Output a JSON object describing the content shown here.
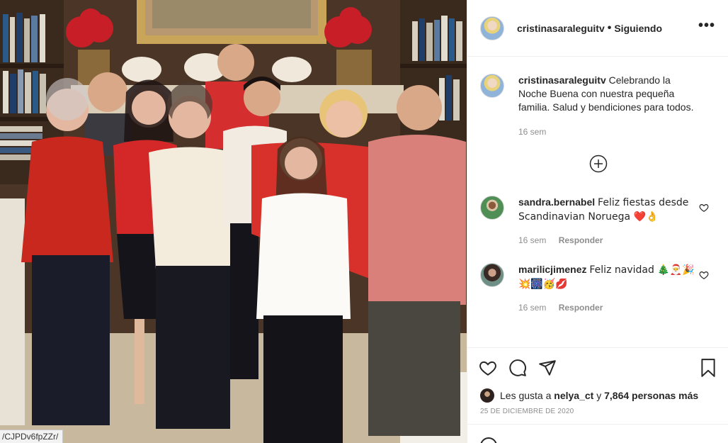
{
  "photo": {
    "url_tooltip": "/CJPDv6fpZZr/",
    "alt": "group photo"
  },
  "post_header": {
    "username": "cristinasaraleguitv",
    "separator": "•",
    "follow_status": "Siguiendo",
    "more_icon": "more-options-icon"
  },
  "caption": {
    "username": "cristinasaraleguitv",
    "text": "Celebrando la Noche Buena con nuestra pequeña familia. Salud y bendiciones para todos.",
    "time": "16 sem"
  },
  "load_more_icon": "plus-circle-icon",
  "comments": [
    {
      "username": "sandra.bernabel",
      "text": "Feliz fiestas desde Scandinavian Noruega ❤️👌",
      "time": "16 sem",
      "reply_label": "Responder"
    },
    {
      "username": "marilicjimenez",
      "text": "Feliz navidad 🎄🎅🎉💥🎆🥳💋",
      "time": "16 sem",
      "reply_label": "Responder"
    }
  ],
  "actions": {
    "like_icon": "heart-icon",
    "comment_icon": "comment-icon",
    "share_icon": "share-icon",
    "save_icon": "bookmark-icon"
  },
  "likes": {
    "prefix": "Les gusta a",
    "user": "nelya_ct",
    "connector": "y",
    "count": "7,864 personas más"
  },
  "date": "25 DE DICIEMBRE DE 2020",
  "colors": {
    "border": "#efefef",
    "text": "#262626",
    "secondary": "#8e8e8e"
  }
}
